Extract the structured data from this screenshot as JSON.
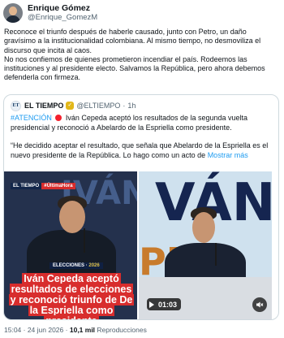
{
  "author": {
    "name": "Enrique Gómez",
    "handle": "@Enrique_GomezM"
  },
  "tweet": {
    "lines": [
      "Reconoce el triunfo después de haberle causado, junto con Petro, un daño gravísimo a la institucionalidad colombiana. Al mismo tiempo, no desmoviliza el discurso que incita al caos.",
      "No nos confiemos de quienes prometieron incendiar el país.  Rodeemos las instituciones y al presidente electo. Salvamos la República, pero ahora debemos defenderla con firmeza."
    ]
  },
  "quoted": {
    "logo_text": "ET",
    "name": "EL TIEMPO",
    "handle": "@ELTIEMPO",
    "separator": "·",
    "time": "1h",
    "hashtag": "#ATENCIÓN",
    "headline": "Iván Cepeda aceptó los resultados de la segunda vuelta presidencial y reconoció a Abelardo de la Espriella como presidente.",
    "quote": "“He decidido aceptar el resultado, que señala que Abelardo de la Espriella es el nuevo presidente de la República. Lo hago como un acto de",
    "show_more": "Mostrar más",
    "media_left": {
      "brand": "EL TIEMPO",
      "tag": "#ÚltimaHora",
      "bg_word": "IVÁN",
      "elections_label": "ELECCIONES",
      "elections_year": "2026",
      "caption": "Iván Cepeda aceptó resultados de elecciones y reconoció triunfo de De la Espriella como presidente"
    },
    "media_right": {
      "bg_word_top": "VÁN",
      "bg_word_bottom": "PE",
      "duration": "01:03"
    }
  },
  "footer": {
    "time": "15:04 · 24 jun 2026",
    "separator": "·",
    "views_count": "10,1 mil",
    "views_label": "Reproducciones"
  },
  "colors": {
    "accent": "#1d9bf0",
    "alert": "#f4212e",
    "verified_gold": "#e2b719",
    "caption_red": "#d82d2d",
    "text_primary": "#0f1419",
    "text_secondary": "#536471"
  }
}
